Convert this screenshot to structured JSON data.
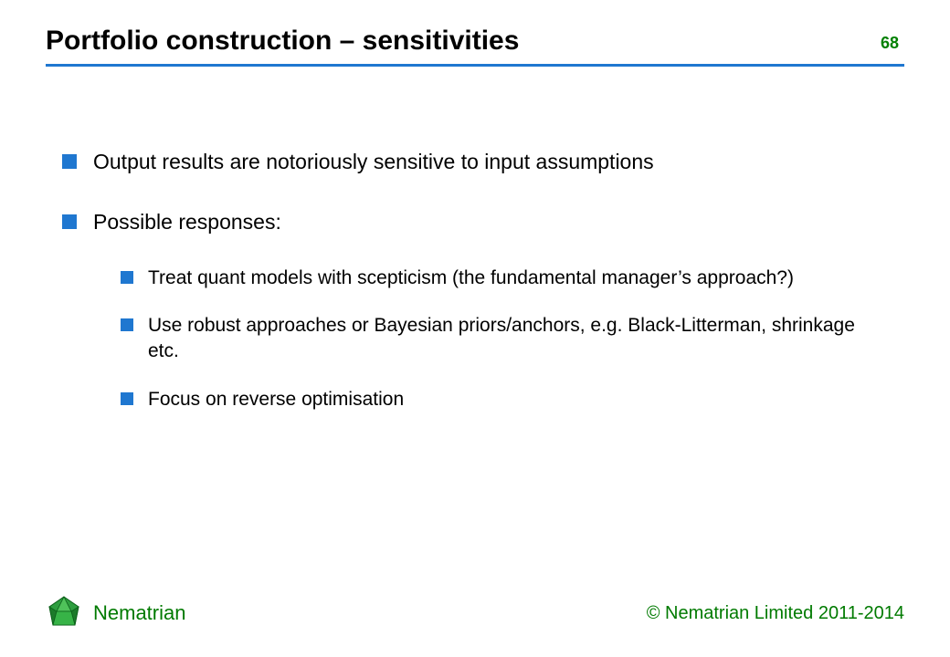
{
  "header": {
    "title": "Portfolio construction – sensitivities",
    "page_number": "68"
  },
  "bullets": [
    {
      "text": "Output results are notoriously sensitive to input assumptions"
    },
    {
      "text": "Possible responses:",
      "children": [
        "Treat quant models with scepticism (the fundamental manager’s approach?)",
        "Use robust approaches or Bayesian priors/anchors, e.g. Black-Litterman, shrinkage etc.",
        "Focus on reverse optimisation"
      ]
    }
  ],
  "footer": {
    "brand": "Nematrian",
    "copyright": "© Nematrian Limited 2011-2014"
  }
}
